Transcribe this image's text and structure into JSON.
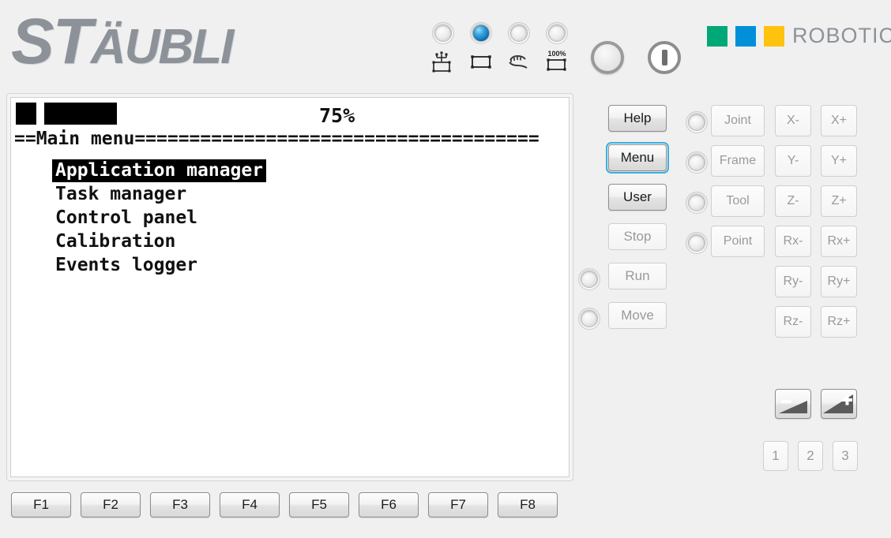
{
  "brand": {
    "logo_cap_s": "S",
    "logo_rest_t": "T",
    "logo_text": "ÄUBLI",
    "logo_full": "STÄUBLI",
    "robotics_word": "ROBOTICS",
    "swatch_colors": [
      "#00a878",
      "#0090da",
      "#ffc20e"
    ],
    "logo_color": "#8d9299"
  },
  "header": {
    "modes": [
      {
        "name": "remote-mode",
        "icon": "network-node-icon",
        "active": false
      },
      {
        "name": "manual-mode",
        "icon": "rect-path-icon",
        "active": true
      },
      {
        "name": "free-mode",
        "icon": "hand-icon",
        "active": false
      },
      {
        "name": "full-speed-mode",
        "icon": "speed-100-icon",
        "active": false,
        "label": "100%"
      }
    ],
    "estop_button": "emergency-stop",
    "power_button": "power"
  },
  "screen": {
    "status_blocks": [
      "",
      ""
    ],
    "speed_percent": "75%",
    "separator": "==Main menu=====================================",
    "menu_items": [
      {
        "label": "Application manager",
        "selected": true
      },
      {
        "label": "Task manager",
        "selected": false
      },
      {
        "label": "Control panel",
        "selected": false
      },
      {
        "label": "Calibration",
        "selected": false
      },
      {
        "label": "Events logger",
        "selected": false
      }
    ]
  },
  "commands": [
    {
      "label": "Help",
      "enabled": true,
      "focused": false,
      "led": false
    },
    {
      "label": "Menu",
      "enabled": true,
      "focused": true,
      "led": false
    },
    {
      "label": "User",
      "enabled": true,
      "focused": false,
      "led": false
    },
    {
      "label": "Stop",
      "enabled": false,
      "focused": false,
      "led": false
    },
    {
      "label": "Run",
      "enabled": false,
      "focused": false,
      "led": true
    },
    {
      "label": "Move",
      "enabled": false,
      "focused": false,
      "led": true
    }
  ],
  "jog_modes": [
    {
      "label": "Joint",
      "enabled": false,
      "led": true
    },
    {
      "label": "Frame",
      "enabled": false,
      "led": true
    },
    {
      "label": "Tool",
      "enabled": false,
      "led": true
    },
    {
      "label": "Point",
      "enabled": false,
      "led": true
    }
  ],
  "axis_keys": [
    {
      "minus": "X-",
      "plus": "X+"
    },
    {
      "minus": "Y-",
      "plus": "Y+"
    },
    {
      "minus": "Z-",
      "plus": "Z+"
    },
    {
      "minus": "Rx-",
      "plus": "Rx+"
    },
    {
      "minus": "Ry-",
      "plus": "Ry+"
    },
    {
      "minus": "Rz-",
      "plus": "Rz+"
    }
  ],
  "speed_keys": [
    {
      "name": "speed-down",
      "sign": "−"
    },
    {
      "name": "speed-up",
      "sign": "+"
    }
  ],
  "numeric_keys": [
    "1",
    "2",
    "3"
  ],
  "function_keys": [
    "F1",
    "F2",
    "F3",
    "F4",
    "F5",
    "F6",
    "F7",
    "F8"
  ]
}
